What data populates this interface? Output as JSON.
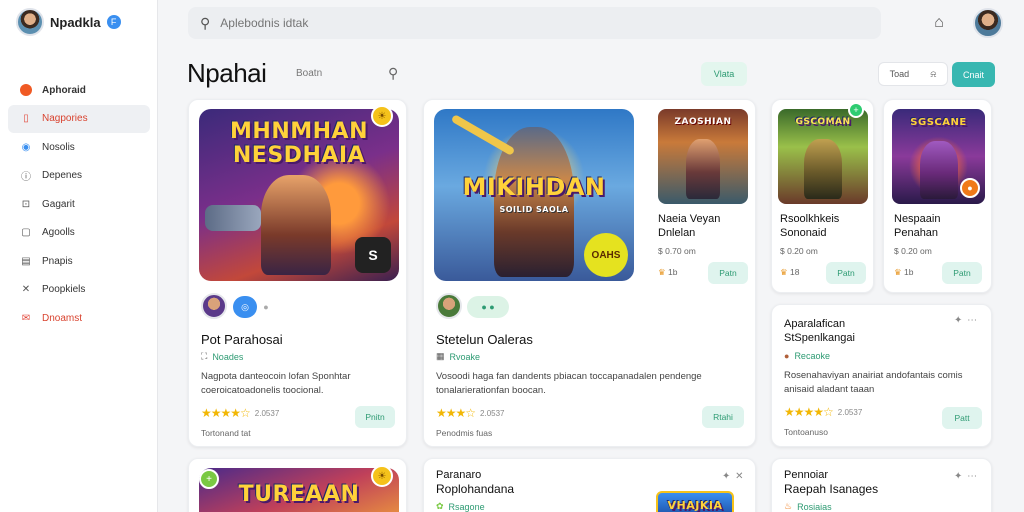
{
  "app": {
    "name": "Npadkla",
    "badge": "F"
  },
  "sidebar": {
    "items": [
      {
        "label": "Aphoraid",
        "icon": "app-icon"
      },
      {
        "label": "Nagpories",
        "icon": "phone-icon"
      },
      {
        "label": "Nosolis",
        "icon": "globe-icon"
      },
      {
        "label": "Depenes",
        "icon": "info-icon"
      },
      {
        "label": "Gagarit",
        "icon": "bag-icon"
      },
      {
        "label": "Agoolls",
        "icon": "page-icon"
      },
      {
        "label": "Pnapis",
        "icon": "chart-icon"
      },
      {
        "label": "Poopkiels",
        "icon": "tools-icon"
      },
      {
        "label": "Dnoamst",
        "icon": "mail-icon"
      }
    ]
  },
  "search": {
    "placeholder": "Aplebodnis idtak"
  },
  "header": {
    "title": "Npahai",
    "subtitle": "Boatn",
    "chip_green": "Vlata",
    "segment_label": "Toad",
    "teal_button": "Cnait"
  },
  "cards": {
    "c1": {
      "art_title_top": "MHNMHAN",
      "art_title_bottom": "NESDHAIA",
      "art_badge": "S",
      "title": "Pot Parahosai",
      "genre": "Noades",
      "description": "Nagpota danteocoin lofan Sponhtar coeroicatoadonelis toocional.",
      "rating_count": "2.0537",
      "meta": "Tortonand tat",
      "action": "Pnitn"
    },
    "c2": {
      "art_title_top": "MIKIHDAN",
      "art_title_sub": "SOILID SAOLA",
      "art_badge": "OAHS",
      "title": "Stetelun Oaleras",
      "genre": "Rvoake",
      "description": "Vosoodi haga fan dandents pbiacan toccapanadalen pendenge tonalarierationfan boocan.",
      "rating_count": "2.0537",
      "meta": "Penodmis fuas",
      "action": "Rtahi"
    },
    "c3": {
      "art_title": "ZAOSHIAN",
      "title_line1": "Naeia Veyan",
      "title_line2": "Dnlelan",
      "price": "$ 0.70 om",
      "count": "1b",
      "action": "Patn"
    },
    "c4": {
      "art_title": "GSCOMAN",
      "title_line1": "Rsoolkhkeis",
      "title_line2": "Sononaid",
      "price": "$ 0.20 om",
      "count": "18",
      "action": "Patn"
    },
    "c5": {
      "art_title": "SGSCANE",
      "title_line1": "Nespaain",
      "title_line2": "Penahan",
      "price": "$ 0.20 om",
      "count": "1b",
      "action": "Patn"
    },
    "c6": {
      "title_line1": "Aparalafican",
      "title_line2": "StSpenlkangai",
      "genre": "Recaoke",
      "description": "Rosenahaviyan anairiat andofantais comis anisaid aladant taaan",
      "rating_count": "2.0537",
      "meta": "Tontoanuso",
      "action": "Patt"
    },
    "c7": {
      "art_title_top": "TUREAAN"
    },
    "c8": {
      "title_line1": "Paranaro",
      "title_line2": "Roplohandana",
      "genre": "Rsagone",
      "art_title": "VHAJKIA"
    },
    "c9": {
      "title_line1": "Pennoiar",
      "title_line2": "Raepah Isanages",
      "genre": "Rosiaias"
    }
  },
  "colors": {
    "accent_teal": "#38b7b1",
    "accent_green": "#2e9b73",
    "danger": "#d9432f",
    "star": "#f2b705"
  }
}
